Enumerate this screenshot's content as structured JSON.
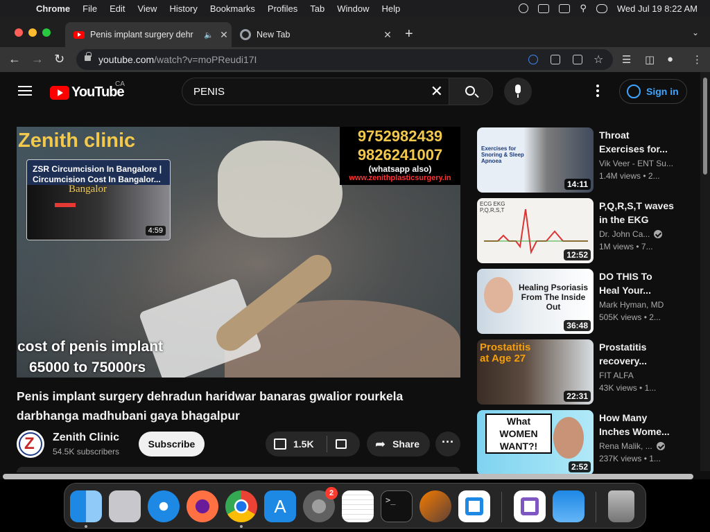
{
  "menubar": {
    "app_name": "Chrome",
    "items": [
      "File",
      "Edit",
      "View",
      "History",
      "Bookmarks",
      "Profiles",
      "Tab",
      "Window",
      "Help"
    ],
    "clock": "Wed Jul 19  8:22 AM"
  },
  "tabs": [
    {
      "title": "Penis implant surgery dehr",
      "active": true,
      "icon": "youtube-icon",
      "audio": true
    },
    {
      "title": "New Tab",
      "active": false,
      "icon": "chrome-icon"
    }
  ],
  "address_bar": {
    "domain": "youtube.com",
    "path": "/watch?v=moPReudi17I"
  },
  "youtube": {
    "logo_text": "YouTube",
    "country": "CA",
    "search_query": "PENIS",
    "sign_in_label": "Sign in"
  },
  "video": {
    "overlay": {
      "clinic_label": "Zenith clinic",
      "phone1": "9752982439",
      "phone2": "9826241007",
      "whatsapp": "(whatsapp also)",
      "website": "www.zenithplasticsurgery.in",
      "cost_line1": "cost of penis implant",
      "cost_line2": "65000 to 75000rs"
    },
    "endcard": {
      "title": "ZSR Circumcision In Bangalore | Circumcision Cost In Bangalor...",
      "city": "Bangalor",
      "duration": "4:59"
    },
    "title": "Penis implant surgery dehradun haridwar banaras gwalior rourkela darbhanga madhubani gaya bhagalpur",
    "channel": "Zenith Clinic",
    "subscribers": "54.5K subscribers",
    "subscribe_label": "Subscribe",
    "likes": "1.5K",
    "share_label": "Share"
  },
  "recommendations": [
    {
      "title": "Throat Exercises for...",
      "channel": "Vik Veer - ENT Su...",
      "views": "1.4M views",
      "age": "2...",
      "duration": "14:11",
      "verified": false,
      "thumb_text": "Exercises for Snoring & Sleep Apnoea"
    },
    {
      "title": "P,Q,R,S,T waves in the EKG",
      "channel": "Dr. John Ca...",
      "views": "1M views",
      "age": "7...",
      "duration": "12:52",
      "verified": true,
      "thumb_text": "ECG EKG P,Q,R,S,T"
    },
    {
      "title": "DO THIS To Heal Your...",
      "channel": "Mark Hyman, MD",
      "views": "505K views",
      "age": "2...",
      "duration": "36:48",
      "verified": false,
      "thumb_text": "Healing Psoriasis From The Inside Out"
    },
    {
      "title": "Prostatitis recovery...",
      "channel": "FIT ALFA",
      "views": "43K views",
      "age": "1...",
      "duration": "22:31",
      "verified": false,
      "thumb_text": "Prostatitis at Age 27"
    },
    {
      "title": "How Many Inches Wome...",
      "channel": "Rena Malik, ...",
      "views": "237K views",
      "age": "1...",
      "duration": "2:52",
      "verified": true,
      "thumb_text": "What WOMEN WANT?!"
    }
  ],
  "dock": {
    "settings_badge": "2"
  }
}
